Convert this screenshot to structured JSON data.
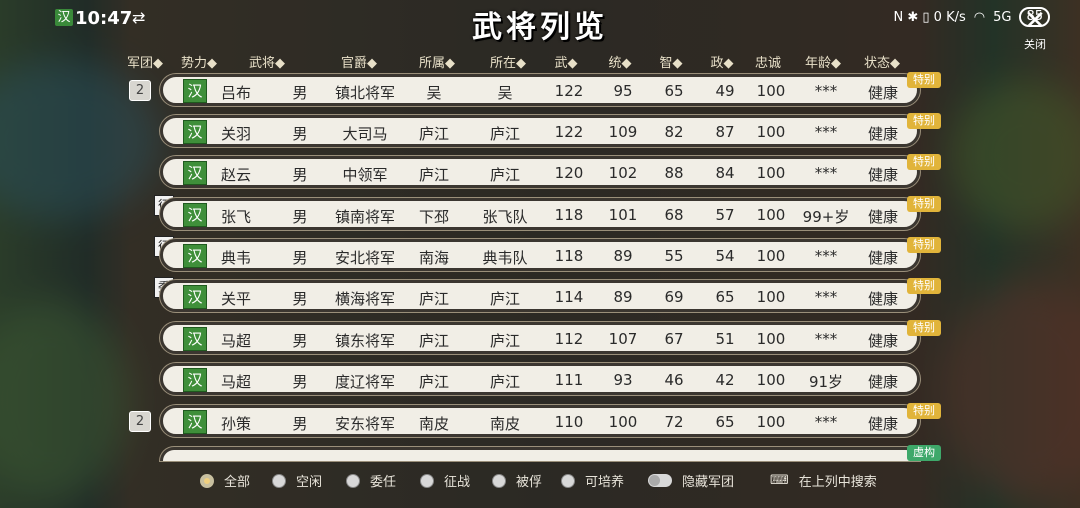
{
  "status_bar": {
    "time": "10:47",
    "faction_icon": "汉",
    "right_icons": "N ✱ ▯ 0 K/s",
    "signal": "5G",
    "battery": "85"
  },
  "title": "武将列览",
  "close": {
    "label": "关闭"
  },
  "headers": [
    "军团◆",
    "势力◆",
    "武将◆",
    "官爵◆",
    "所属◆",
    "所在◆",
    "武◆",
    "统◆",
    "智◆",
    "政◆",
    "忠诚",
    "年龄◆",
    "状态◆"
  ],
  "rows": [
    {
      "corps": "2",
      "stamp": "",
      "faction": "汉",
      "name": "吕布",
      "gender": "男",
      "rank": "镇北将军",
      "belong": "吴",
      "location": "吴",
      "war": "122",
      "lead": "95",
      "intel": "65",
      "pol": "49",
      "loyal": "100",
      "age": "***",
      "state": "健康",
      "tag": "特别"
    },
    {
      "corps": "",
      "stamp": "",
      "faction": "汉",
      "name": "关羽",
      "gender": "男",
      "rank": "大司马",
      "belong": "庐江",
      "location": "庐江",
      "war": "122",
      "lead": "109",
      "intel": "82",
      "pol": "87",
      "loyal": "100",
      "age": "***",
      "state": "健康",
      "tag": "特别"
    },
    {
      "corps": "",
      "stamp": "",
      "faction": "汉",
      "name": "赵云",
      "gender": "男",
      "rank": "中领军",
      "belong": "庐江",
      "location": "庐江",
      "war": "120",
      "lead": "102",
      "intel": "88",
      "pol": "84",
      "loyal": "100",
      "age": "***",
      "state": "健康",
      "tag": "特别"
    },
    {
      "corps": "",
      "stamp": "征",
      "faction": "汉",
      "name": "张飞",
      "gender": "男",
      "rank": "镇南将军",
      "belong": "下邳",
      "location": "张飞队",
      "war": "118",
      "lead": "101",
      "intel": "68",
      "pol": "57",
      "loyal": "100",
      "age": "99+岁",
      "state": "健康",
      "tag": "特别"
    },
    {
      "corps": "",
      "stamp": "征",
      "faction": "汉",
      "name": "典韦",
      "gender": "男",
      "rank": "安北将军",
      "belong": "南海",
      "location": "典韦队",
      "war": "118",
      "lead": "89",
      "intel": "55",
      "pol": "54",
      "loyal": "100",
      "age": "***",
      "state": "健康",
      "tag": "特别"
    },
    {
      "corps": "",
      "stamp": "委",
      "faction": "汉",
      "name": "关平",
      "gender": "男",
      "rank": "横海将军",
      "belong": "庐江",
      "location": "庐江",
      "war": "114",
      "lead": "89",
      "intel": "69",
      "pol": "65",
      "loyal": "100",
      "age": "***",
      "state": "健康",
      "tag": "特别"
    },
    {
      "corps": "",
      "stamp": "",
      "faction": "汉",
      "name": "马超",
      "gender": "男",
      "rank": "镇东将军",
      "belong": "庐江",
      "location": "庐江",
      "war": "112",
      "lead": "107",
      "intel": "67",
      "pol": "51",
      "loyal": "100",
      "age": "***",
      "state": "健康",
      "tag": "特别"
    },
    {
      "corps": "",
      "stamp": "",
      "faction": "汉",
      "name": "马超",
      "gender": "男",
      "rank": "度辽将军",
      "belong": "庐江",
      "location": "庐江",
      "war": "111",
      "lead": "93",
      "intel": "46",
      "pol": "42",
      "loyal": "100",
      "age": "91岁",
      "state": "健康",
      "tag": ""
    },
    {
      "corps": "2",
      "stamp": "",
      "faction": "汉",
      "name": "孙策",
      "gender": "男",
      "rank": "安东将军",
      "belong": "南皮",
      "location": "南皮",
      "war": "110",
      "lead": "100",
      "intel": "72",
      "pol": "65",
      "loyal": "100",
      "age": "***",
      "state": "健康",
      "tag": "特别"
    }
  ],
  "partial_row_tag": "虚构",
  "filters": [
    "全部",
    "空闲",
    "委任",
    "征战",
    "被俘",
    "可培养"
  ],
  "selected_filter": "全部",
  "hide_corps_label": "隐藏军团",
  "search_label": "在上列中搜索",
  "colors": {
    "faction_green": "#3f8f3a",
    "tag_gold": "#e1b43a",
    "tag_green": "#3ea86a",
    "row_bg": "#f1eee6"
  }
}
